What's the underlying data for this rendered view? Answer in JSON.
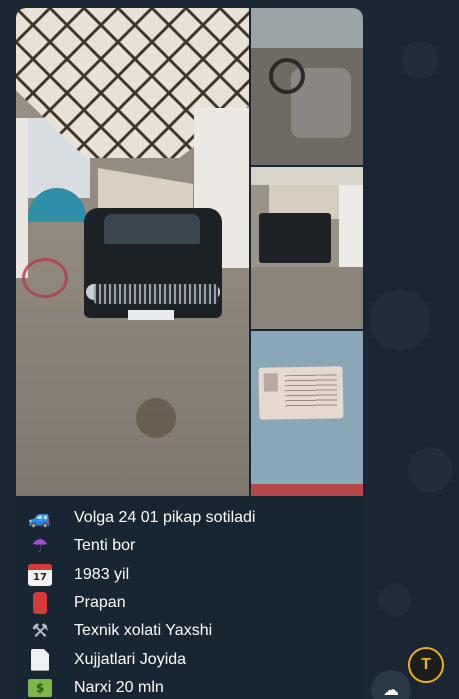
{
  "message": {
    "photos": [
      {
        "name": "garage-front",
        "kind": "car front in garage"
      },
      {
        "name": "interior",
        "kind": "car interior"
      },
      {
        "name": "rear",
        "kind": "car rear"
      },
      {
        "name": "document",
        "kind": "registration document"
      }
    ],
    "lines": [
      {
        "icon": "pickup-truck-icon",
        "glyph": "🚙",
        "text": "Volga 24 01 pikap sotiladi"
      },
      {
        "icon": "umbrella-icon",
        "glyph": "☂",
        "text": "Tenti bor"
      },
      {
        "icon": "calendar-icon",
        "glyph": "17",
        "text": "1983 yil"
      },
      {
        "icon": "fire-extinguisher-icon",
        "glyph": "",
        "text": "Prapan"
      },
      {
        "icon": "tools-icon",
        "glyph": "⚒",
        "text": "Texnik xolati Yaxshi"
      },
      {
        "icon": "document-icon",
        "glyph": "",
        "text": "Xujjatlari Joyida"
      },
      {
        "icon": "money-icon",
        "glyph": "$",
        "text": "Narxi 20 mln"
      }
    ]
  },
  "ui": {
    "forward_glyph": "T",
    "cloud_glyph": "☁"
  },
  "colors": {
    "background": "#17212b",
    "bubble": "#182533",
    "text": "#ffffff",
    "accent_gold": "#e8b21a"
  }
}
